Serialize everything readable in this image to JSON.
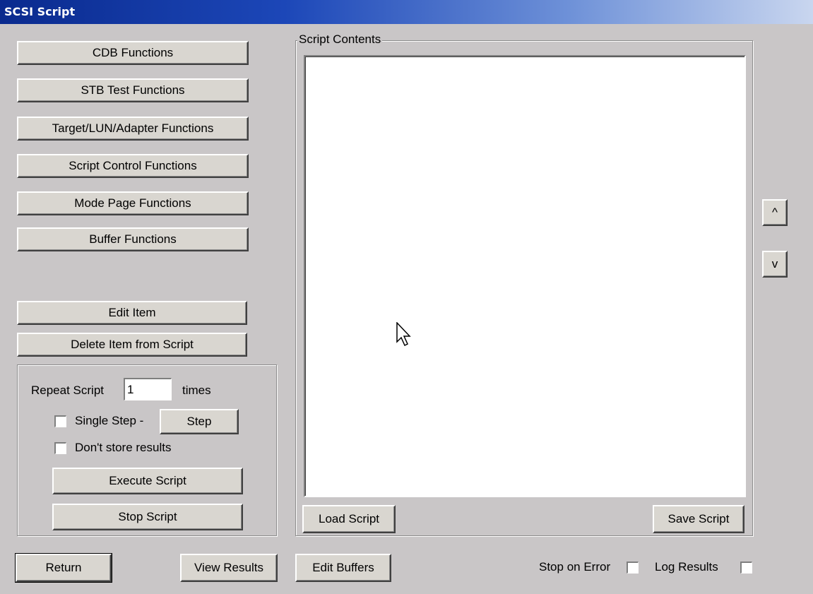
{
  "window": {
    "title": "SCSI Script"
  },
  "functions": {
    "cdb": "CDB Functions",
    "stb": "STB Test Functions",
    "target": "Target/LUN/Adapter Functions",
    "script_control": "Script Control Functions",
    "mode_page": "Mode Page Functions",
    "buffer": "Buffer Functions"
  },
  "item_actions": {
    "edit": "Edit Item",
    "delete": "Delete Item from Script"
  },
  "execution": {
    "repeat_label": "Repeat Script",
    "repeat_value": "1",
    "times_label": "times",
    "single_step_label": "Single Step -",
    "single_step_checked": false,
    "step_button": "Step",
    "dont_store_label": "Don't store results",
    "dont_store_checked": false,
    "execute_button": "Execute Script",
    "stop_button": "Stop Script"
  },
  "script_contents": {
    "group_label": "Script Contents",
    "items": [],
    "load_button": "Load Script",
    "save_button": "Save Script"
  },
  "reorder": {
    "up": "^",
    "down": "v"
  },
  "bottom_bar": {
    "return_button": "Return",
    "view_results_button": "View Results",
    "edit_buffers_button": "Edit Buffers",
    "stop_on_error_label": "Stop on Error",
    "stop_on_error_checked": false,
    "log_results_label": "Log Results",
    "log_results_checked": false
  },
  "colors": {
    "window_bg": "#c9c6c7",
    "title_gradient_start": "#0a2a8e",
    "title_gradient_end": "#c9d6ef",
    "button_face": "#d9d6d0"
  }
}
